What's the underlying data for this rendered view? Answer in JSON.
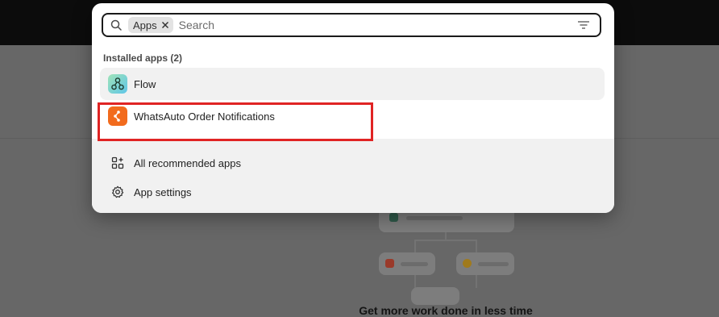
{
  "search": {
    "filter_chip": "Apps",
    "placeholder": "Search",
    "value": ""
  },
  "installed_apps": {
    "title": "Installed apps (2)",
    "items": [
      {
        "label": "Flow",
        "icon": "flow-icon"
      },
      {
        "label": "WhatsAuto Order Notifications",
        "icon": "whatsauto-icon"
      }
    ]
  },
  "footer": {
    "items": [
      {
        "label": "All recommended apps",
        "icon": "apps-grid-icon"
      },
      {
        "label": "App settings",
        "icon": "gear-icon"
      }
    ]
  },
  "background": {
    "caption": "Get more work done in less time"
  },
  "colors": {
    "highlight": "#e02424",
    "flow_icon": "#7ad6a0",
    "whatsauto_icon": "#f26b1d"
  }
}
